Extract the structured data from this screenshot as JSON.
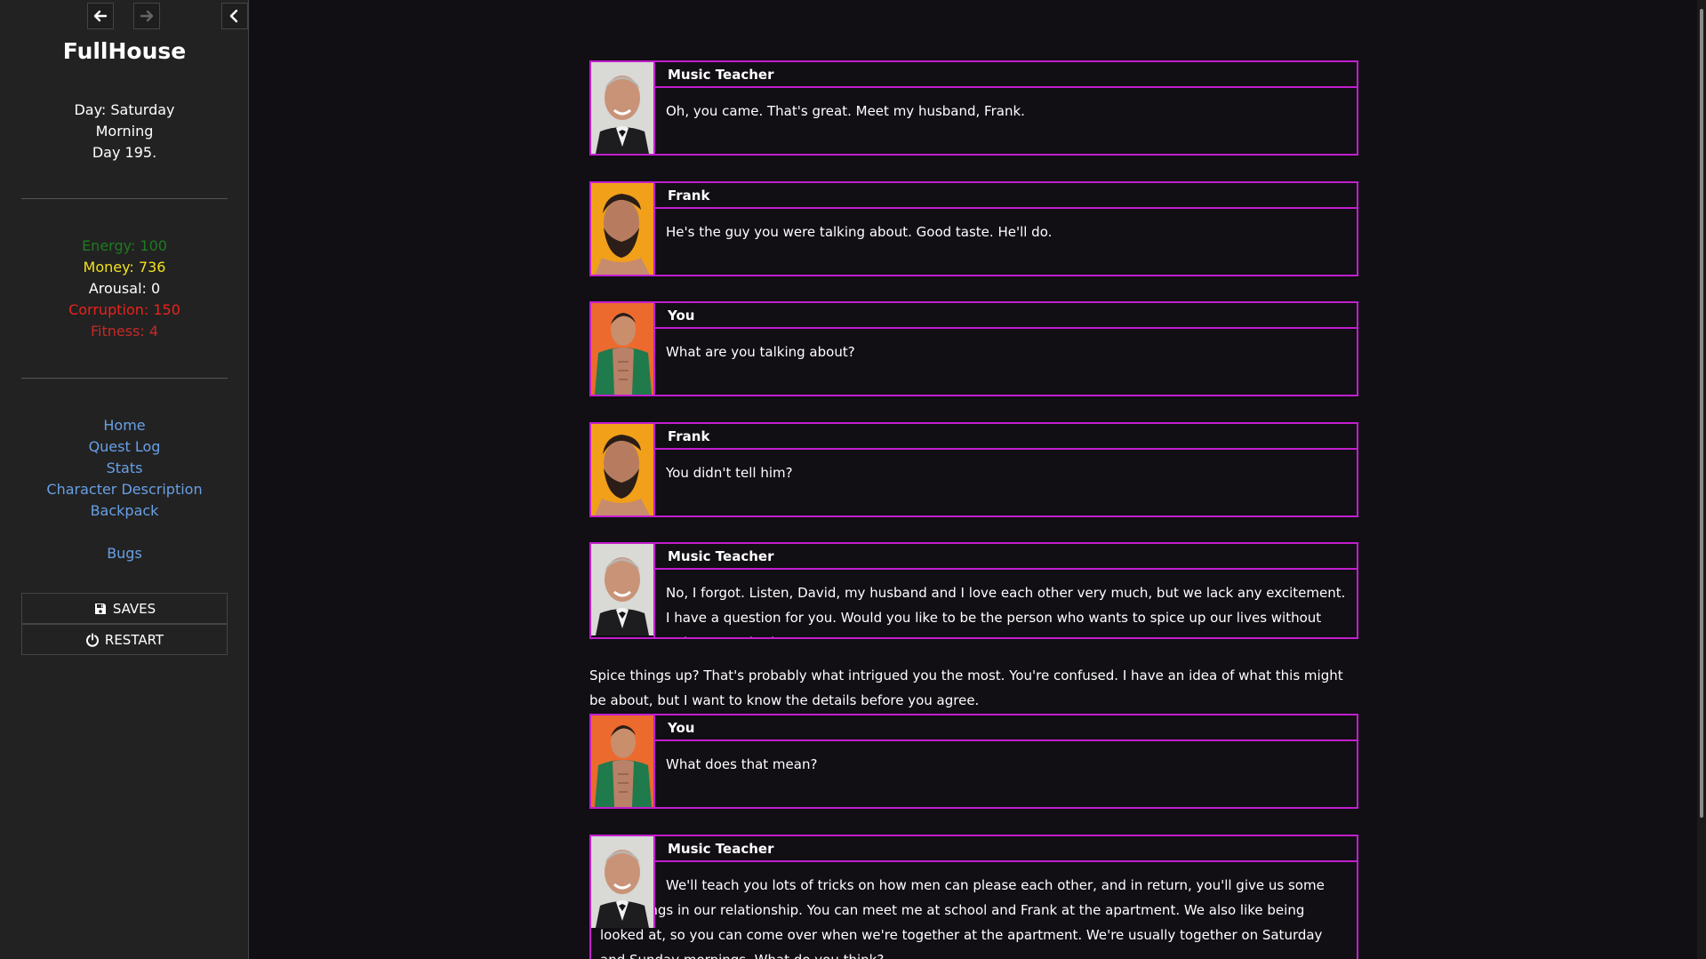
{
  "sidebar": {
    "title": "FullHouse",
    "time": {
      "day": "Day: Saturday",
      "period": "Morning",
      "count": "Day 195."
    },
    "stats": {
      "energy": "Energy: 100",
      "money": "Money: 736",
      "arousal": "Arousal: 0",
      "corruption": "Corruption: 150",
      "fitness": "Fitness: 4"
    },
    "stat_colors": {
      "energy": "#1f7a1f",
      "money": "#f2e11e",
      "arousal": "#ffffff",
      "corruption": "#e8231c",
      "fitness": "#c42a26"
    },
    "nav": [
      "Home",
      "Quest Log",
      "Stats",
      "Character Description",
      "Backpack"
    ],
    "bugs_link": "Bugs",
    "saves_label": "SAVES",
    "restart_label": "RESTART",
    "icons": {
      "back": "arrow-left-icon",
      "forward": "arrow-right-icon",
      "collapse": "chevron-left-icon",
      "saves": "floppy-disk-icon",
      "restart": "power-icon"
    }
  },
  "dialogue": [
    {
      "speaker": "Music Teacher",
      "text": "Oh, you came. That's great. Meet my husband, Frank."
    },
    {
      "speaker": "Frank",
      "text": "He's the guy you were talking about. Good taste. He'll do."
    },
    {
      "speaker": "You",
      "text": "What are you talking about?"
    },
    {
      "speaker": "Frank",
      "text": "You didn't tell him?"
    },
    {
      "speaker": "Music Teacher",
      "text": "No, I forgot. Listen, David, my husband and I love each other very much, but we lack any excitement. I have a question for you. Would you like to be the person who wants to spice up our lives without strings attached?"
    },
    {
      "speaker": "You",
      "text": "What does that mean?"
    },
    {
      "speaker": "Music Teacher",
      "text": "We'll teach you lots of tricks on how men can please each other, and in return, you'll give us some new things in our relationship. You can meet me at school and Frank at the apartment. We also like being looked at, so you can come over when we're together at the apartment. We're usually together on Saturday and Sunday mornings. What do you think?"
    }
  ],
  "narration": "Spice things up? That's probably what intrigued you the most. You're confused. I have an idea of what this might be about, but I want to know the details before you agree.",
  "colors": {
    "accent": "#c21ecf",
    "link": "#68a0e6",
    "background": "#110e14",
    "sidebar": "#222222"
  }
}
